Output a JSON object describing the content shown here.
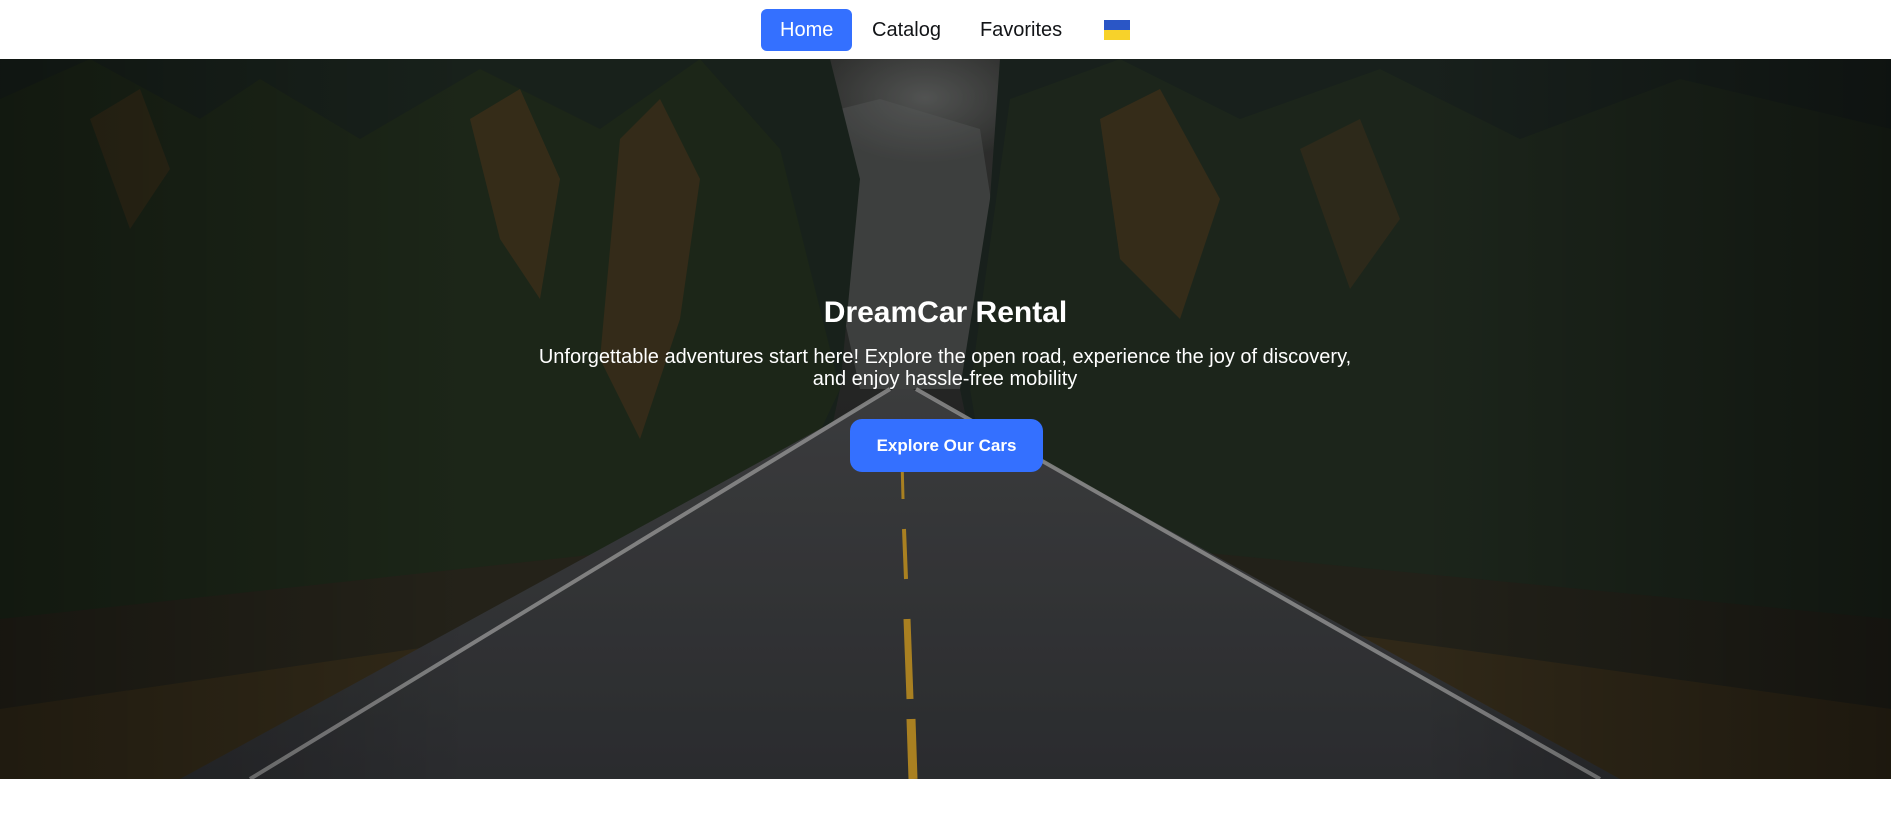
{
  "nav": {
    "items": [
      {
        "label": "Home",
        "active": true
      },
      {
        "label": "Catalog",
        "active": false
      },
      {
        "label": "Favorites",
        "active": false
      }
    ],
    "language_flag": "ukraine-flag-icon",
    "accent_color": "#3470ff"
  },
  "hero": {
    "title": "DreamCar Rental",
    "subtitle": "Unforgettable adventures start here! Explore the open road, experience the joy of discovery, and enjoy hassle-free mobility",
    "cta_label": "Explore Our Cars",
    "background": "forest-road-image"
  }
}
